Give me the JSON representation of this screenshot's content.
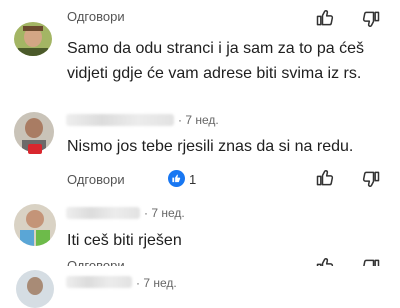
{
  "comments": [
    {
      "reply_label": "Одговори",
      "text": "Samo da odu stranci i ja sam za to pa ćeš vidjeti gdje će vam adrese biti svima iz rs."
    },
    {
      "time": "· 7 нед.",
      "text": "Nismo jos tebe rjesili znas da si na redu.",
      "reply_label": "Одговори",
      "like_count": "1"
    },
    {
      "time": "· 7 нед.",
      "text": "Iti ceš biti rješen"
    },
    {
      "time": "· 7 нед.",
      "reply_label": "Одговори"
    }
  ],
  "icons": {
    "like": "thumbs-up-icon",
    "dislike": "thumbs-down-icon",
    "like_badge": "blue-like-badge-icon",
    "flag_badge": "flag-badge-icon"
  },
  "colors": {
    "like_badge": "#1877f2",
    "flag_red": "#d9272e"
  }
}
